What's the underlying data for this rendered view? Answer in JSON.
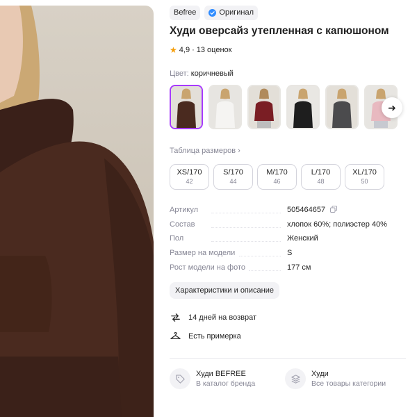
{
  "brand_badge": "Befree",
  "original_badge": "Оригинал",
  "product_title": "Худи оверсайз утепленная с капюшоном",
  "rating": {
    "value": "4,9",
    "separator": "·",
    "count_text": "13 оценок"
  },
  "color": {
    "label": "Цвет:",
    "value": "коричневый",
    "swatches": [
      {
        "name": "коричневый",
        "hex": "#4a2a1f",
        "selected": true
      },
      {
        "name": "белый",
        "hex": "#f1f0ee",
        "selected": false
      },
      {
        "name": "бордовый",
        "hex": "#7a1e24",
        "selected": false
      },
      {
        "name": "черный",
        "hex": "#1e1e1e",
        "selected": false
      },
      {
        "name": "серый",
        "hex": "#4b4b4d",
        "selected": false
      },
      {
        "name": "розовый",
        "hex": "#e8b9c0",
        "selected": false
      }
    ]
  },
  "size_table_link": "Таблица размеров",
  "sizes": [
    {
      "name": "XS/170",
      "ru": "42"
    },
    {
      "name": "S/170",
      "ru": "44"
    },
    {
      "name": "M/170",
      "ru": "46"
    },
    {
      "name": "L/170",
      "ru": "48"
    },
    {
      "name": "XL/170",
      "ru": "50"
    }
  ],
  "specs": [
    {
      "key": "Артикул",
      "value": "505464657"
    },
    {
      "key": "Состав",
      "value": "хлопок 60%; полиэстер 40%"
    },
    {
      "key": "Пол",
      "value": "Женский"
    },
    {
      "key": "Размер на модели",
      "value": "S"
    },
    {
      "key": "Рост модели на фото",
      "value": "177 см"
    }
  ],
  "characteristics_button": "Характеристики и описание",
  "features": [
    {
      "icon": "return-arrows-icon",
      "text": "14 дней на возврат"
    },
    {
      "icon": "hanger-icon",
      "text": "Есть примерка"
    }
  ],
  "brand_link": {
    "title": "Худи BEFREE",
    "subtitle": "В каталог бренда",
    "icon": "tag-icon"
  },
  "category_link": {
    "title": "Худи",
    "subtitle": "Все товары категории",
    "icon": "layers-icon"
  },
  "colors": {
    "accent": "#a73afd",
    "verified": "#2f8cff",
    "star": "#f59e0b",
    "muted_text": "#868695"
  }
}
